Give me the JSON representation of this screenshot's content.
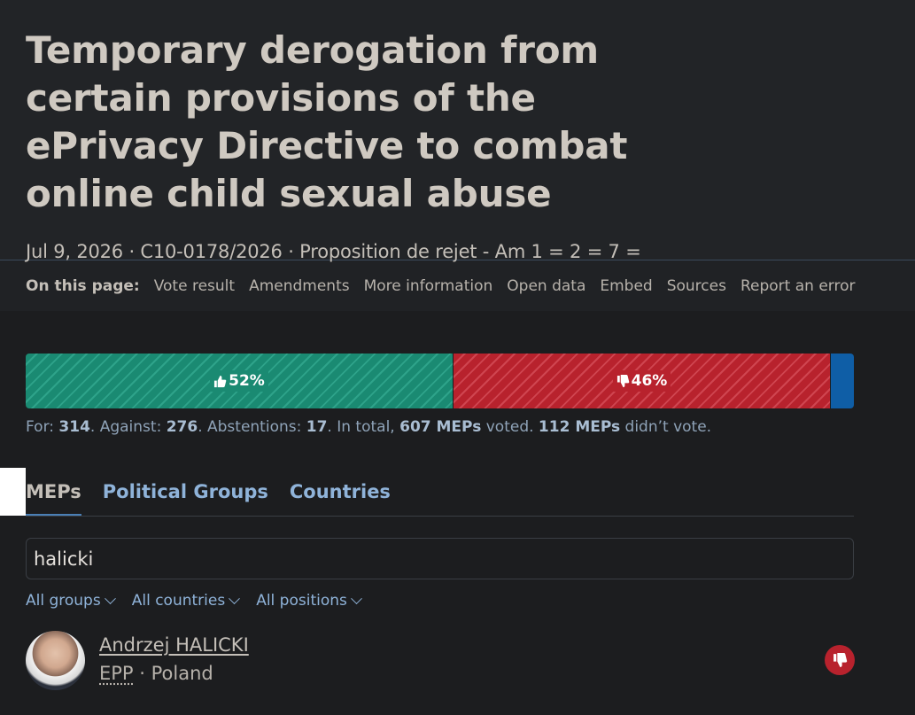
{
  "vote": {
    "title": "Temporary derogation from certain provisions of the ePrivacy Directive to combat online child sexual abuse",
    "meta": "Jul 9, 2026 · C10-0178/2026 · Proposition de rejet - Am 1 = 2 = 7 ="
  },
  "on_this_page": {
    "label": "On this page:",
    "links": [
      "Vote result",
      "Amendments",
      "More information",
      "Open data",
      "Embed",
      "Sources",
      "Report an error"
    ]
  },
  "result_bar": {
    "for_pct_label": "52%",
    "against_pct_label": "46%",
    "for_fraction": 0.517,
    "against_fraction": 0.455,
    "abstention_fraction": 0.028,
    "colors": {
      "for": "#1a8a72",
      "against": "#b8222d",
      "abstention": "#0f5ea6"
    }
  },
  "summary": {
    "for_label": "For: ",
    "for_count": "314",
    "against_label": ". Against: ",
    "against_count": "276",
    "abst_label": ". Abstentions: ",
    "abst_count": "17",
    "total_label": ". In total, ",
    "total_count": "607 MEPs",
    "voted_label": " voted. ",
    "notvoted_count": "112 MEPs",
    "notvoted_label": " didn’t vote."
  },
  "tabs": [
    "MEPs",
    "Political Groups",
    "Countries"
  ],
  "search": {
    "value": "halicki"
  },
  "filters": [
    "All groups",
    "All countries",
    "All positions"
  ],
  "mep": {
    "name": "Andrzej HALICKI",
    "group": "EPP",
    "separator": " · ",
    "country": "Poland",
    "position_icon": "thumbs-down-icon"
  }
}
